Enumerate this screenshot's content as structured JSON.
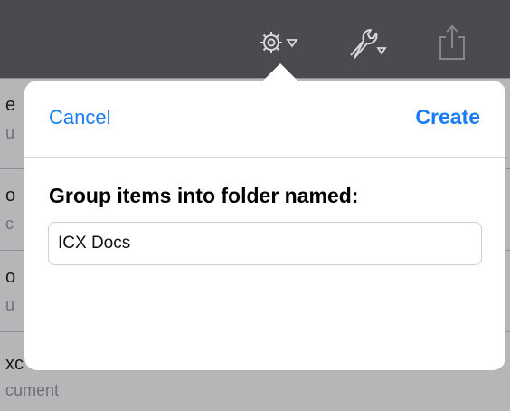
{
  "toolbar": {
    "icons": [
      "gear-menu-icon",
      "wrench-menu-icon",
      "share-icon"
    ]
  },
  "background_list": {
    "rows": [
      {
        "title": "e",
        "subtitle": "u"
      },
      {
        "title": "o",
        "subtitle": "c"
      },
      {
        "title": "o",
        "subtitle": "u"
      },
      {
        "title": "xc",
        "subtitle": "cument"
      }
    ]
  },
  "dialog": {
    "cancel_label": "Cancel",
    "create_label": "Create",
    "prompt": "Group items into folder named:",
    "folder_name_value": "ICX Docs"
  },
  "colors": {
    "accent": "#1a7cf5",
    "toolbar": "#4a4b50",
    "dim_overlay": "#b6b6b9"
  }
}
